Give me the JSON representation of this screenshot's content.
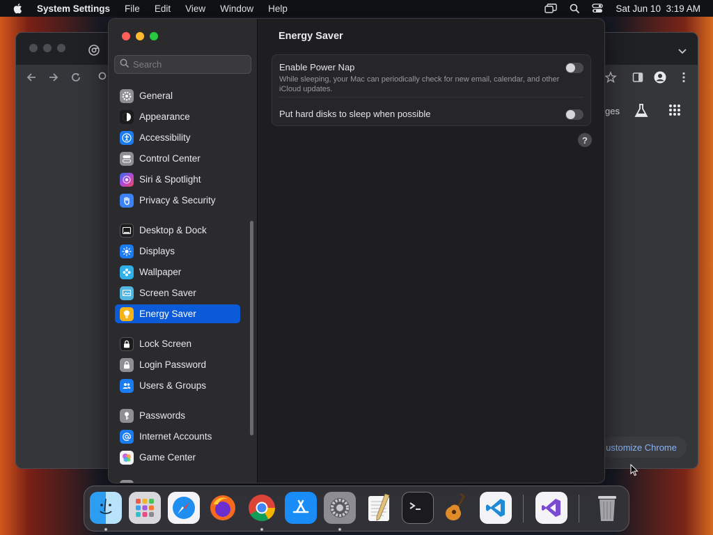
{
  "menubar": {
    "app_name": "System Settings",
    "items": [
      "File",
      "Edit",
      "View",
      "Window",
      "Help"
    ],
    "datetime": "Sat Jun 10  3:19 AM"
  },
  "chrome": {
    "images_fragment": "ges",
    "customize_label": "ustomize Chrome"
  },
  "settings": {
    "search_placeholder": "Search",
    "sidebar": [
      {
        "label": "General",
        "icon": "gear-icon",
        "color": "#8e8e93"
      },
      {
        "label": "Appearance",
        "icon": "appearance-icon",
        "color": "#1c1c1e"
      },
      {
        "label": "Accessibility",
        "icon": "accessibility-icon",
        "color": "#1a7cf0"
      },
      {
        "label": "Control Center",
        "icon": "control-center-icon",
        "color": "#8e8e93"
      },
      {
        "label": "Siri & Spotlight",
        "icon": "siri-icon",
        "color": "#b04ad6"
      },
      {
        "label": "Privacy & Security",
        "icon": "hand-icon",
        "color": "#3b82f6"
      },
      {
        "label": "Desktop & Dock",
        "icon": "dock-icon",
        "color": "#1c1c1e"
      },
      {
        "label": "Displays",
        "icon": "sun-icon",
        "color": "#1a7cf0"
      },
      {
        "label": "Wallpaper",
        "icon": "wallpaper-icon",
        "color": "#30b0e8"
      },
      {
        "label": "Screen Saver",
        "icon": "screen-saver-icon",
        "color": "#52b7e0"
      },
      {
        "label": "Energy Saver",
        "icon": "lightbulb-icon",
        "color": "#f5b316"
      },
      {
        "label": "Lock Screen",
        "icon": "lock-icon",
        "color": "#1c1c1e"
      },
      {
        "label": "Login Password",
        "icon": "login-lock-icon",
        "color": "#8e8e93"
      },
      {
        "label": "Users & Groups",
        "icon": "users-icon",
        "color": "#1a7cf0"
      },
      {
        "label": "Passwords",
        "icon": "key-icon",
        "color": "#8e8e93"
      },
      {
        "label": "Internet Accounts",
        "icon": "at-icon",
        "color": "#1a7cf0"
      },
      {
        "label": "Game Center",
        "icon": "game-center-icon",
        "color": "#e8e8ea"
      }
    ],
    "selected": "Energy Saver",
    "pane_title": "Energy Saver",
    "rows": [
      {
        "title": "Enable Power Nap",
        "description": "While sleeping, your Mac can periodically check for new email, calendar, and other iCloud updates.",
        "enabled": false
      },
      {
        "title": "Put hard disks to sleep when possible",
        "enabled": false
      }
    ],
    "help_label": "?"
  },
  "dock": {
    "apps": [
      "finder-icon",
      "launchpad-icon",
      "safari-icon",
      "firefox-icon",
      "chrome-icon",
      "app-store-icon",
      "system-settings-icon",
      "textedit-icon",
      "terminal-icon",
      "garageband-icon",
      "vscode-icon",
      "visual-studio-icon",
      "trash-icon"
    ]
  }
}
